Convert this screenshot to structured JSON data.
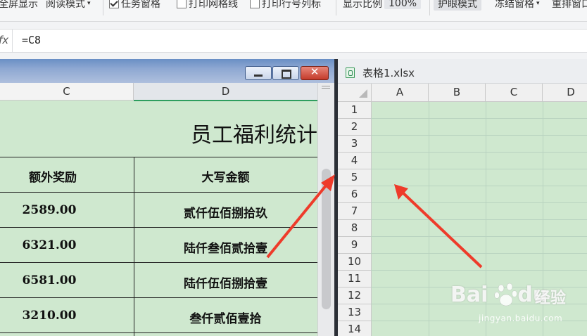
{
  "ribbon": {
    "full_screen": "全屏显示",
    "reading_mode": "阅读模式",
    "task_pane": "任务窗格",
    "print_gridlines": "打印网格线",
    "print_headings": "打印行号列标",
    "zoom_label": "显示比例",
    "zoom_value": "100%",
    "eye_protection": "护眼模式",
    "freeze_panes": "冻结窗格",
    "rearrange": "重排窗口"
  },
  "formula_bar": {
    "fx": "fx",
    "value": "=C8"
  },
  "left_window": {
    "columns": [
      "C",
      "D"
    ],
    "sheet_title": "员工福利统计",
    "headers": [
      "额外奖励",
      "大写金额"
    ],
    "rows": [
      [
        "2589.00",
        "贰仟伍佰捌拾玖"
      ],
      [
        "6321.00",
        "陆仟叁佰贰拾壹"
      ],
      [
        "6581.00",
        "陆仟伍佰捌拾壹"
      ],
      [
        "3210.00",
        "叁仟贰佰壹拾"
      ]
    ],
    "colors": {
      "sheet_bg": "#cfe8cf",
      "titlebar": "#7f9dcc",
      "close": "#c94a3a"
    }
  },
  "right_window": {
    "file_name": "表格1.xlsx",
    "columns": [
      "A",
      "B",
      "C",
      "D"
    ],
    "rows": [
      "1",
      "2",
      "3",
      "4",
      "5",
      "6",
      "7",
      "8",
      "9",
      "10",
      "11",
      "12",
      "13",
      "14"
    ]
  },
  "watermark": {
    "brand": "Bai",
    "brand2": "du",
    "sub": "经验",
    "url": "jingyan.baidu.com"
  },
  "annotation_color": "#ee3b2a"
}
